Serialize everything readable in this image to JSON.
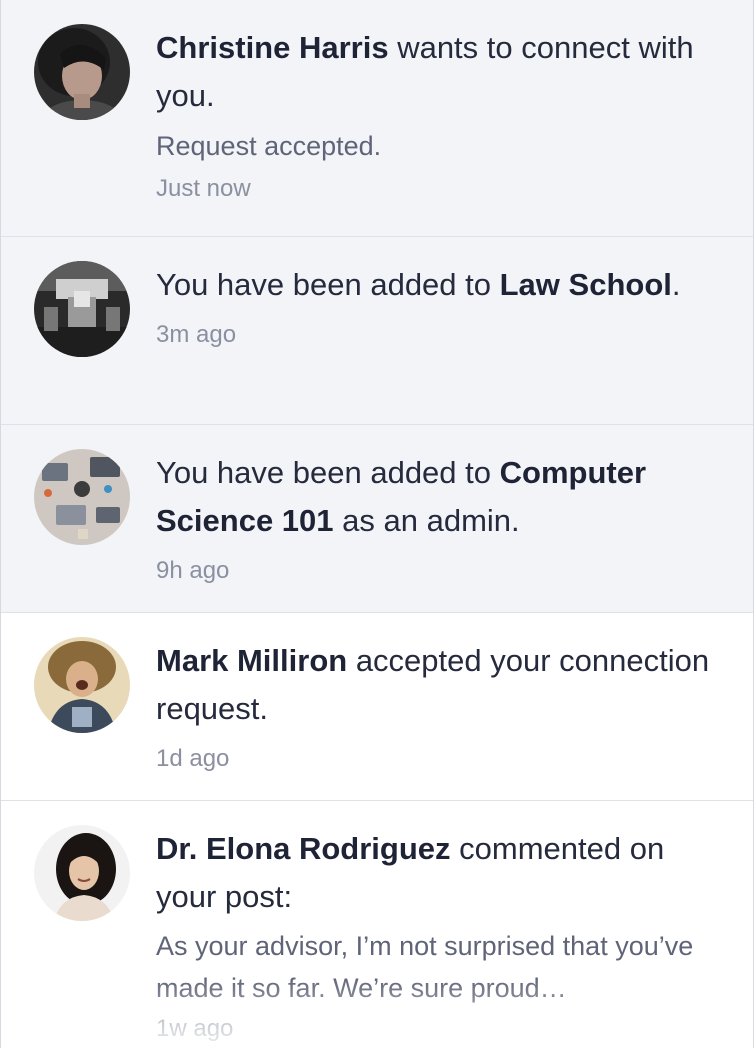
{
  "notifications": [
    {
      "actor": "Christine Harris",
      "text": " wants to connect with you.",
      "status": "Request accepted.",
      "time": "Just now",
      "avatar_icon": "avatar-christine-harris"
    },
    {
      "prefix": "You have been added to ",
      "group": "Law School",
      "suffix": ".",
      "time": "3m ago",
      "avatar_icon": "avatar-law-school"
    },
    {
      "prefix": "You have been added to ",
      "group": "Computer Science 101",
      "suffix": " as an admin.",
      "time": "9h ago",
      "avatar_icon": "avatar-computer-science"
    },
    {
      "actor": "Mark Milliron",
      "text": " accepted your connection request.",
      "time": "1d ago",
      "avatar_icon": "avatar-mark-milliron"
    },
    {
      "actor": "Dr. Elona Rodriguez",
      "text": " commented on your post:",
      "comment": "As your advisor, I’m not surprised that you’ve made it so far. We’re sure proud…",
      "time": "1w ago",
      "avatar_icon": "avatar-elona-rodriguez"
    }
  ],
  "colors": {
    "unread_bg": "#f3f4f8",
    "read_bg": "#ffffff",
    "text_primary": "#252a3d",
    "text_secondary": "#5f6478",
    "text_time": "#8b90a0"
  }
}
